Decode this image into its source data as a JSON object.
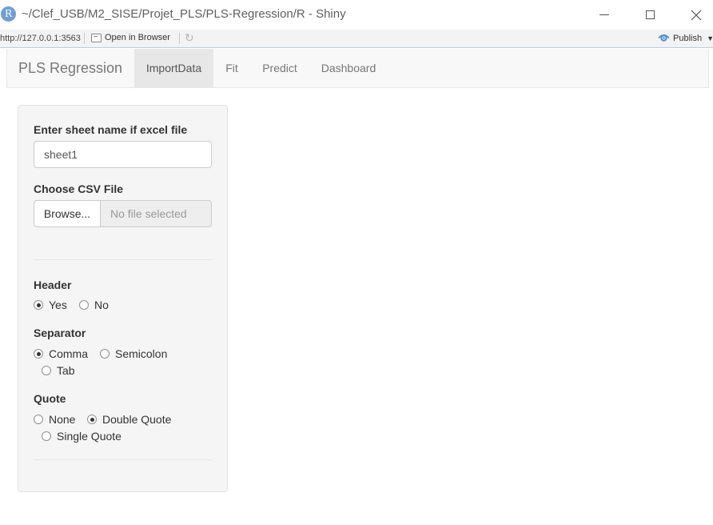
{
  "window": {
    "title": "~/Clef_USB/M2_SISE/Projet_PLS/PLS-Regression/R - Shiny",
    "logo_letter": "R"
  },
  "toolbar": {
    "url": "http://127.0.0.1:3563",
    "open_in_browser": "Open in Browser",
    "publish": "Publish"
  },
  "navbar": {
    "brand": "PLS Regression",
    "tabs": [
      {
        "label": "ImportData",
        "active": true
      },
      {
        "label": "Fit",
        "active": false
      },
      {
        "label": "Predict",
        "active": false
      },
      {
        "label": "Dashboard",
        "active": false
      }
    ]
  },
  "sidebar": {
    "sheet_label": "Enter sheet name if excel file",
    "sheet_value": "sheet1",
    "csv_label": "Choose CSV File",
    "browse_label": "Browse...",
    "file_placeholder": "No file selected",
    "header": {
      "label": "Header",
      "options": [
        {
          "label": "Yes",
          "checked": true
        },
        {
          "label": "No",
          "checked": false
        }
      ]
    },
    "separator": {
      "label": "Separator",
      "options": [
        {
          "label": "Comma",
          "checked": true
        },
        {
          "label": "Semicolon",
          "checked": false
        },
        {
          "label": "Tab",
          "checked": false
        }
      ]
    },
    "quote": {
      "label": "Quote",
      "options": [
        {
          "label": "None",
          "checked": false
        },
        {
          "label": "Double Quote",
          "checked": true
        },
        {
          "label": "Single Quote",
          "checked": false
        }
      ]
    }
  },
  "colors": {
    "navbar_bg": "#f8f8f8",
    "active_tab_bg": "#e7e7e7",
    "well_bg": "#f5f5f5",
    "r_logo": "#6f9fd8",
    "publish_icon": "#4a8fd4"
  }
}
